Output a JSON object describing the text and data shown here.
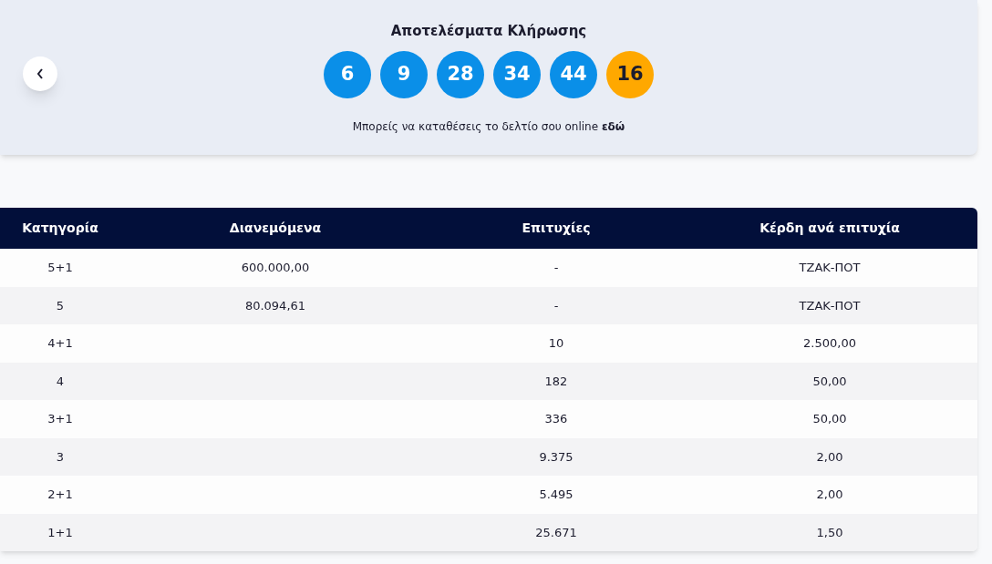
{
  "header": {
    "title": "Αποτελέσματα Κλήρωσης",
    "balls": [
      {
        "number": "6",
        "kind": "main"
      },
      {
        "number": "9",
        "kind": "main"
      },
      {
        "number": "28",
        "kind": "main"
      },
      {
        "number": "34",
        "kind": "main"
      },
      {
        "number": "44",
        "kind": "main"
      },
      {
        "number": "16",
        "kind": "bonus"
      }
    ],
    "note": "Μπορείς να καταθέσεις το δελτίο σου online **εδώ**"
  },
  "table": {
    "columns": [
      "Κατηγορία",
      "Διανεμόμενα",
      "Επιτυχίες",
      "Κέρδη ανά επιτυχία"
    ],
    "rows": [
      [
        "5+1",
        "600.000,00",
        "-",
        "ΤΖΑΚ-ΠΟΤ"
      ],
      [
        "5",
        "80.094,61",
        "-",
        "ΤΖΑΚ-ΠΟΤ"
      ],
      [
        "4+1",
        "",
        "10",
        "2.500,00"
      ],
      [
        "4",
        "",
        "182",
        "50,00"
      ],
      [
        "3+1",
        "",
        "336",
        "50,00"
      ],
      [
        "3",
        "",
        "9.375",
        "2,00"
      ],
      [
        "2+1",
        "",
        "5.495",
        "2,00"
      ],
      [
        "1+1",
        "",
        "25.671",
        "1,50"
      ]
    ]
  }
}
